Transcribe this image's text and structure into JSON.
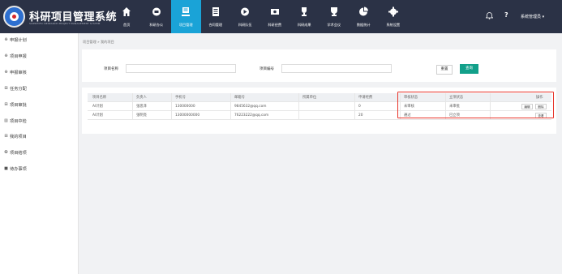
{
  "header": {
    "title": "科研项目管理系统",
    "subtitle": "SCIENTIFIC RESEARCH PROJECT MANAGEMENT SYSTEM",
    "nav": [
      {
        "label": "首页",
        "icon": "home-icon"
      },
      {
        "label": "科研办公",
        "icon": "office-icon"
      },
      {
        "label": "项目管理",
        "icon": "project-icon",
        "active": true
      },
      {
        "label": "合同管理",
        "icon": "contract-icon"
      },
      {
        "label": "科研队伍",
        "icon": "team-icon"
      },
      {
        "label": "科研经费",
        "icon": "funds-icon"
      },
      {
        "label": "科研成果",
        "icon": "trophy-icon"
      },
      {
        "label": "学术会议",
        "icon": "conference-icon"
      },
      {
        "label": "数据统计",
        "icon": "chart-icon"
      },
      {
        "label": "系统设置",
        "icon": "gear-icon"
      }
    ],
    "user": "系统管理员 ▾",
    "help": "?"
  },
  "sidebar": {
    "items": [
      {
        "label": "申报计划",
        "icon": "⊕"
      },
      {
        "label": "项目申报",
        "icon": "⊕"
      },
      {
        "label": "申报审核",
        "icon": "⊕"
      },
      {
        "label": "任务分配",
        "icon": "⊞"
      },
      {
        "label": "项目审批",
        "icon": "⊞"
      },
      {
        "label": "项目中检",
        "icon": "▥"
      },
      {
        "label": "我的项目",
        "icon": "⊞"
      },
      {
        "label": "项目结项",
        "icon": "✪"
      },
      {
        "label": "待办事项",
        "icon": "■"
      }
    ]
  },
  "breadcrumb": {
    "parent": "项目管理",
    "sep": "»",
    "current": "我的项目"
  },
  "search": {
    "name_label": "项目名称",
    "code_label": "项目编号",
    "reset_label": "重置",
    "query_label": "查询"
  },
  "table": {
    "columns": [
      "项目名称",
      "负责人",
      "手机号",
      "邮箱号",
      "所属单位",
      "申请经费",
      "审核状态",
      "立项状态",
      "操作"
    ],
    "rows": [
      {
        "name": "AI计划",
        "owner": "张思泽",
        "phone": "130000000",
        "email": "9845632@qq.com",
        "unit": "",
        "funds": "0",
        "audit": "未审核",
        "approve": "未审批",
        "ops": [
          "编辑",
          "删除"
        ]
      },
      {
        "name": "AI计划",
        "owner": "张明亮",
        "phone": "13000000000",
        "email": "76223222@qq.com",
        "unit": "",
        "funds": "20",
        "audit": "通过",
        "approve": "已立项",
        "ops": [
          "查看"
        ]
      }
    ]
  },
  "colors": {
    "topbar": "#2b3246",
    "active": "#1aa3d7",
    "query": "#12a08a",
    "highlight": "#e8342a"
  }
}
